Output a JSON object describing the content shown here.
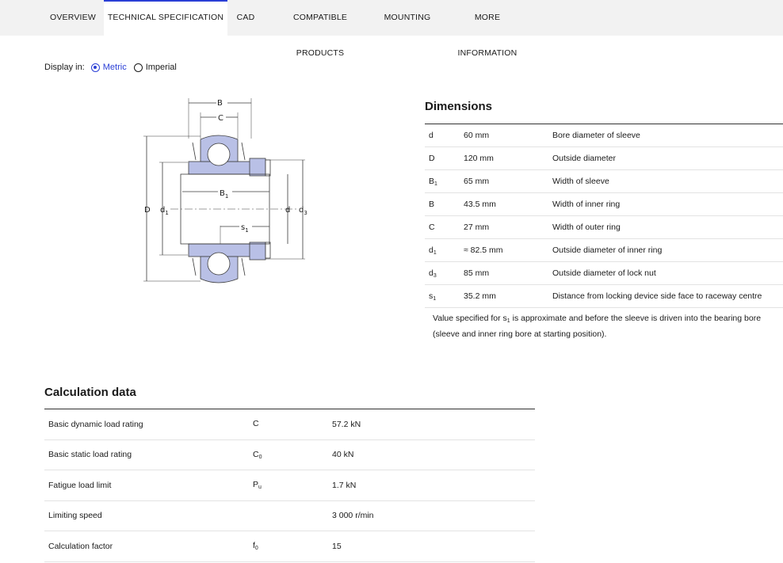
{
  "tabs": [
    {
      "label": "OVERVIEW"
    },
    {
      "label": "TECHNICAL SPECIFICATION"
    },
    {
      "label": "CAD"
    },
    {
      "label": "COMPATIBLE PRODUCTS"
    },
    {
      "label": "MOUNTING"
    },
    {
      "label": "MORE INFORMATION"
    }
  ],
  "display": {
    "label": "Display in:",
    "metric": "Metric",
    "imperial": "Imperial",
    "selected": "Metric"
  },
  "drawing": {
    "labels": {
      "B": "B",
      "C": "C",
      "B1": "B",
      "B1_sub": "1",
      "s1": "s",
      "s1_sub": "1",
      "D": "D",
      "d1": "d",
      "d1_sub": "1",
      "d": "d",
      "d3": "d",
      "d3_sub": "3"
    },
    "colors": {
      "fill": "#b9c0e6",
      "stroke": "#3a3a3a"
    }
  },
  "dimensions": {
    "title": "Dimensions",
    "rows": [
      {
        "sym": "d",
        "sub": "",
        "value": "60 mm",
        "desc": "Bore diameter of sleeve"
      },
      {
        "sym": "D",
        "sub": "",
        "value": "120 mm",
        "desc": "Outside diameter"
      },
      {
        "sym": "B",
        "sub": "1",
        "value": "65 mm",
        "desc": "Width of sleeve"
      },
      {
        "sym": "B",
        "sub": "",
        "value": "43.5 mm",
        "desc": "Width of inner ring"
      },
      {
        "sym": "C",
        "sub": "",
        "value": "27 mm",
        "desc": "Width of outer ring"
      },
      {
        "sym": "d",
        "sub": "1",
        "value": "≈ 82.5 mm",
        "desc": "Outside diameter of inner ring"
      },
      {
        "sym": "d",
        "sub": "3",
        "value": "85 mm",
        "desc": "Outside diameter of lock nut"
      },
      {
        "sym": "s",
        "sub": "1",
        "value": "35.2 mm",
        "desc": "Distance from locking device side face to raceway centre"
      }
    ],
    "note_prefix": "Value specified for s",
    "note_sub": "1",
    "note_suffix": " is approximate and before the sleeve is driven into the bearing bore (sleeve and inner ring bore at starting position)."
  },
  "calculation": {
    "title": "Calculation data",
    "rows": [
      {
        "name": "Basic dynamic load rating",
        "sym": "C",
        "sub": "",
        "value": "57.2 kN"
      },
      {
        "name": "Basic static load rating",
        "sym": "C",
        "sub": "0",
        "value": "40 kN"
      },
      {
        "name": "Fatigue load limit",
        "sym": "P",
        "sub": "u",
        "value": "1.7 kN"
      },
      {
        "name": "Limiting speed",
        "sym": "",
        "sub": "",
        "value": "3 000 r/min"
      },
      {
        "name": "Calculation factor",
        "sym": "f",
        "sub": "0",
        "value": "15"
      }
    ]
  }
}
